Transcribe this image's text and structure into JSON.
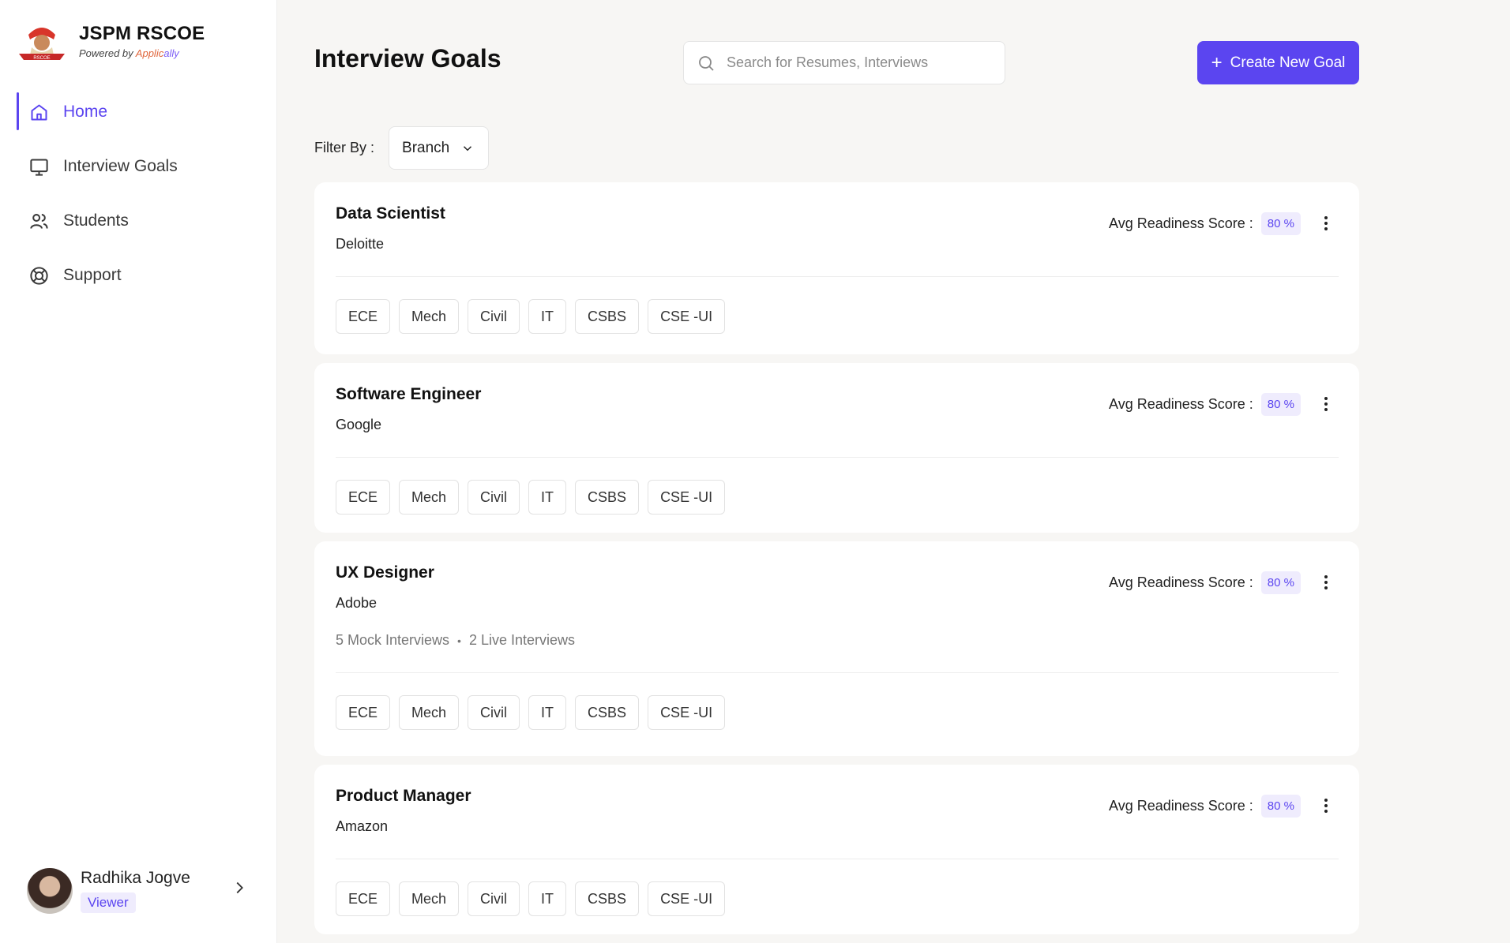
{
  "brand": {
    "name": "JSPM RSCOE",
    "powered_prefix": "Powered by",
    "powered_app": "Applic",
    "powered_ally": "ally",
    "logo_label": "RSCOE"
  },
  "nav": {
    "items": [
      {
        "label": "Home",
        "icon": "home-icon",
        "active": true
      },
      {
        "label": "Interview Goals",
        "icon": "monitor-icon"
      },
      {
        "label": "Students",
        "icon": "users-icon"
      },
      {
        "label": "Support",
        "icon": "lifebuoy-icon"
      }
    ]
  },
  "user": {
    "name": "Radhika Jogve",
    "role": "Viewer"
  },
  "header": {
    "title": "Interview Goals",
    "search_placeholder": "Search for Resumes, Interviews",
    "create_button": "Create New Goal"
  },
  "filter": {
    "label": "Filter By :",
    "selected": "Branch"
  },
  "score_label": "Avg Readiness Score :",
  "cards": [
    {
      "title": "Data Scientist",
      "company": "Deloitte",
      "score": "80 %",
      "tags": [
        "ECE",
        "Mech",
        "Civil",
        "IT",
        "CSBS",
        "CSE -UI"
      ]
    },
    {
      "title": "Software Engineer",
      "company": "Google",
      "score": "80 %",
      "tags": [
        "ECE",
        "Mech",
        "Civil",
        "IT",
        "CSBS",
        "CSE -UI"
      ]
    },
    {
      "title": "UX Designer",
      "company": "Adobe",
      "score": "80 %",
      "mock": "5 Mock Interviews",
      "live": "2 Live Interviews",
      "tags": [
        "ECE",
        "Mech",
        "Civil",
        "IT",
        "CSBS",
        "CSE -UI"
      ]
    },
    {
      "title": "Product Manager",
      "company": "Amazon",
      "score": "80 %",
      "tags": [
        "ECE",
        "Mech",
        "Civil",
        "IT",
        "CSBS",
        "CSE -UI"
      ]
    }
  ],
  "colors": {
    "accent": "#5b45f0",
    "accent_bg": "#efecfd",
    "background": "#f7f6f4"
  }
}
